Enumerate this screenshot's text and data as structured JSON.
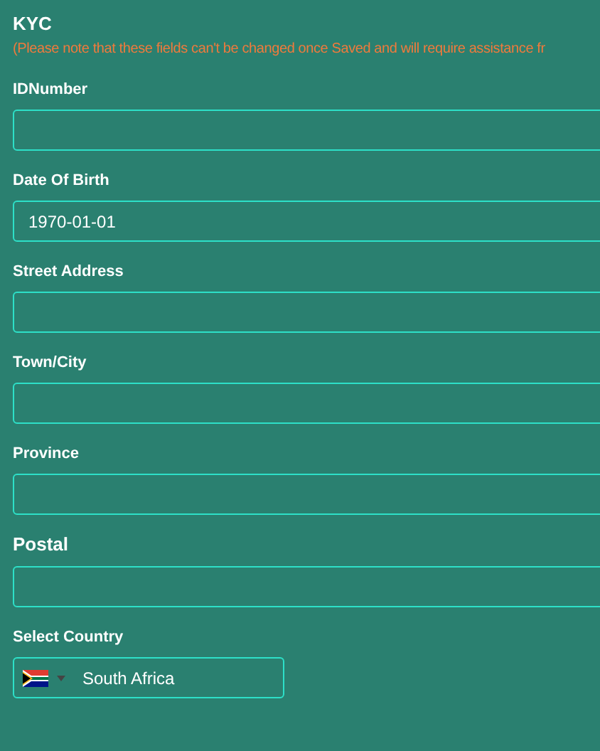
{
  "section": {
    "title": "KYC",
    "note": "(Please note that these fields can't be changed once Saved and will require assistance fr"
  },
  "fields": [
    {
      "kind": "text",
      "label": "IDNumber"
    },
    {
      "kind": "text",
      "label": "Date Of Birth",
      "value": "1970-01-01"
    },
    {
      "kind": "text",
      "label": "Street Address"
    },
    {
      "kind": "text",
      "label": "Town/City"
    },
    {
      "kind": "text",
      "label": "Province"
    },
    {
      "kind": "text-large-label",
      "label": "Postal"
    },
    {
      "kind": "country",
      "label": "Select Country",
      "value": "South Africa"
    }
  ]
}
